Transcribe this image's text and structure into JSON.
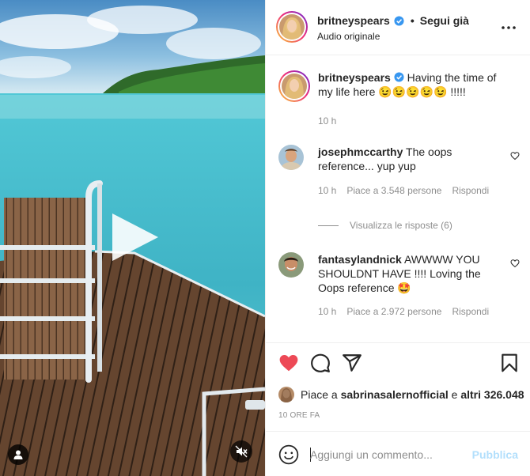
{
  "post": {
    "username": "britneyspears",
    "follow_status": "Segui già",
    "separator": "•",
    "audio": "Audio originale"
  },
  "caption": {
    "username": "britneyspears",
    "text": "Having the time of my life here",
    "emojis": "😉😉😉😉😉",
    "trailing": "!!!!!",
    "time": "10 h"
  },
  "comments": [
    {
      "username": "josephmccarthy",
      "text": "The oops reference... yup yup",
      "time": "10 h",
      "likes": "Piace a 3.548 persone",
      "reply": "Rispondi"
    },
    {
      "username": "fantasylandnick",
      "text": "AWWWW YOU SHOULDNT HAVE !!!! Loving the Oops reference 🤩",
      "time": "10 h",
      "likes": "Piace a 2.972 persone",
      "reply": "Rispondi"
    }
  ],
  "view_replies": "Visualizza le risposte (6)",
  "likes_summary": {
    "prefix": "Piace a",
    "user": "sabrinasalernofficial",
    "middle": "e",
    "others": "altri 326.048"
  },
  "timestamp": "10 ORE FA",
  "add_comment": {
    "placeholder": "Aggiungi un commento...",
    "publish_label": "Pubblica"
  },
  "colors": {
    "like_red": "#ed4956",
    "verified_blue": "#3897f0",
    "publish_disabled": "#b2dffc",
    "secondary_text": "#8e8e8e"
  },
  "icons": {
    "like": "heart-filled-icon",
    "comment": "comment-bubble-icon",
    "share": "paper-plane-icon",
    "save": "bookmark-icon",
    "emoji": "smiley-icon",
    "mute": "speaker-muted-icon",
    "user_tag": "person-icon",
    "more": "ellipsis-icon",
    "play": "play-icon"
  }
}
